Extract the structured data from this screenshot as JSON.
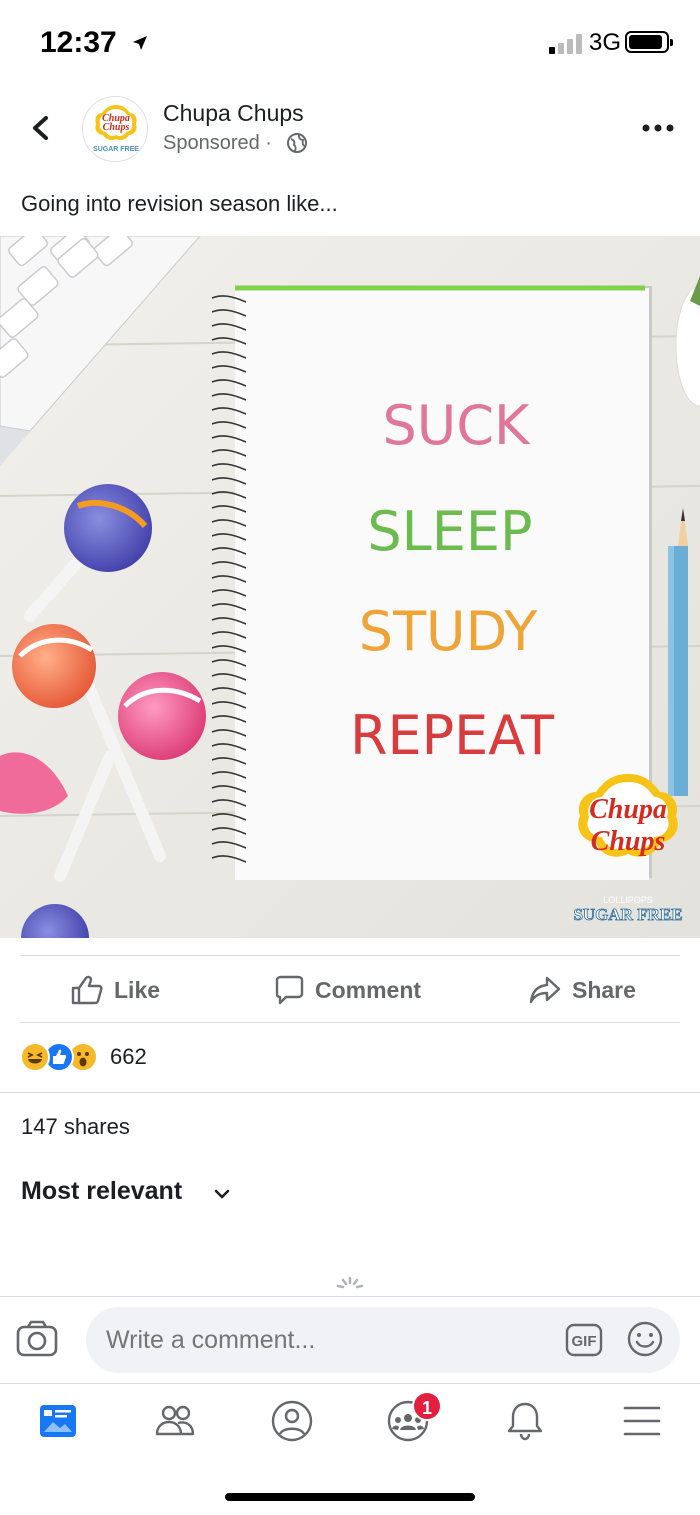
{
  "status_bar": {
    "time": "12:37",
    "network": "3G"
  },
  "post": {
    "page_name": "Chupa Chups",
    "sponsored_label": "Sponsored ·",
    "caption": "Going into revision season like...",
    "image": {
      "notebook_lines": [
        "SUCK",
        "SLEEP",
        "STUDY",
        "REPEAT"
      ],
      "line_colors": [
        "#e0779a",
        "#6cbb4e",
        "#efa437",
        "#d93c3c"
      ],
      "brand_logo_text": [
        "Chupa",
        "Chups"
      ],
      "brand_sub_text": "LOLLIPOPS",
      "brand_tag": "SUGAR FREE",
      "avatar_logo_text": [
        "Chupa",
        "Chups"
      ],
      "avatar_tag": "SUGAR FREE"
    }
  },
  "actions": {
    "like": "Like",
    "comment": "Comment",
    "share": "Share"
  },
  "reactions": {
    "count": "662"
  },
  "shares_text": "147 shares",
  "sort_label": "Most relevant",
  "comment_box": {
    "placeholder": "Write a comment...",
    "gif_label": "GIF"
  },
  "tab_bar": {
    "groups_badge": "1"
  },
  "colors": {
    "accent_blue": "#1877f2",
    "badge_red": "#e41e3f",
    "chupa_yellow": "#f7c317",
    "chupa_red": "#d52b1e"
  }
}
